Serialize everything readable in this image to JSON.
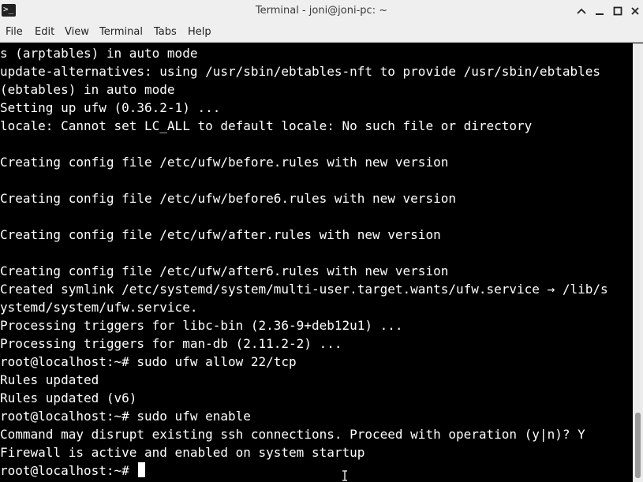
{
  "window": {
    "title": "Terminal - joni@joni-pc: ~",
    "icons": {
      "app": "terminal-icon",
      "shade": "chevron-up-icon",
      "minimize": "minimize-icon",
      "maximize": "maximize-icon",
      "close": "close-icon"
    },
    "app_icon_glyph": ">_"
  },
  "menu": {
    "items": [
      "File",
      "Edit",
      "View",
      "Terminal",
      "Tabs",
      "Help"
    ]
  },
  "terminal": {
    "lines": [
      "s (arptables) in auto mode",
      "update-alternatives: using /usr/sbin/ebtables-nft to provide /usr/sbin/ebtables",
      "(ebtables) in auto mode",
      "Setting up ufw (0.36.2-1) ...",
      "locale: Cannot set LC_ALL to default locale: No such file or directory",
      "",
      "Creating config file /etc/ufw/before.rules with new version",
      "",
      "Creating config file /etc/ufw/before6.rules with new version",
      "",
      "Creating config file /etc/ufw/after.rules with new version",
      "",
      "Creating config file /etc/ufw/after6.rules with new version",
      "Created symlink /etc/systemd/system/multi-user.target.wants/ufw.service → /lib/s",
      "ystemd/system/ufw.service.",
      "Processing triggers for libc-bin (2.36-9+deb12u1) ...",
      "Processing triggers for man-db (2.11.2-2) ...",
      "root@localhost:~# sudo ufw allow 22/tcp",
      "Rules updated",
      "Rules updated (v6)",
      "root@localhost:~# sudo ufw enable",
      "Command may disrupt existing ssh connections. Proceed with operation (y|n)? Y",
      "Firewall is active and enabled on system startup"
    ],
    "prompt": "root@localhost:~# "
  },
  "colors": {
    "terminal_bg": "#000000",
    "terminal_fg": "#ffffff",
    "chrome_bg": "#efefef"
  }
}
